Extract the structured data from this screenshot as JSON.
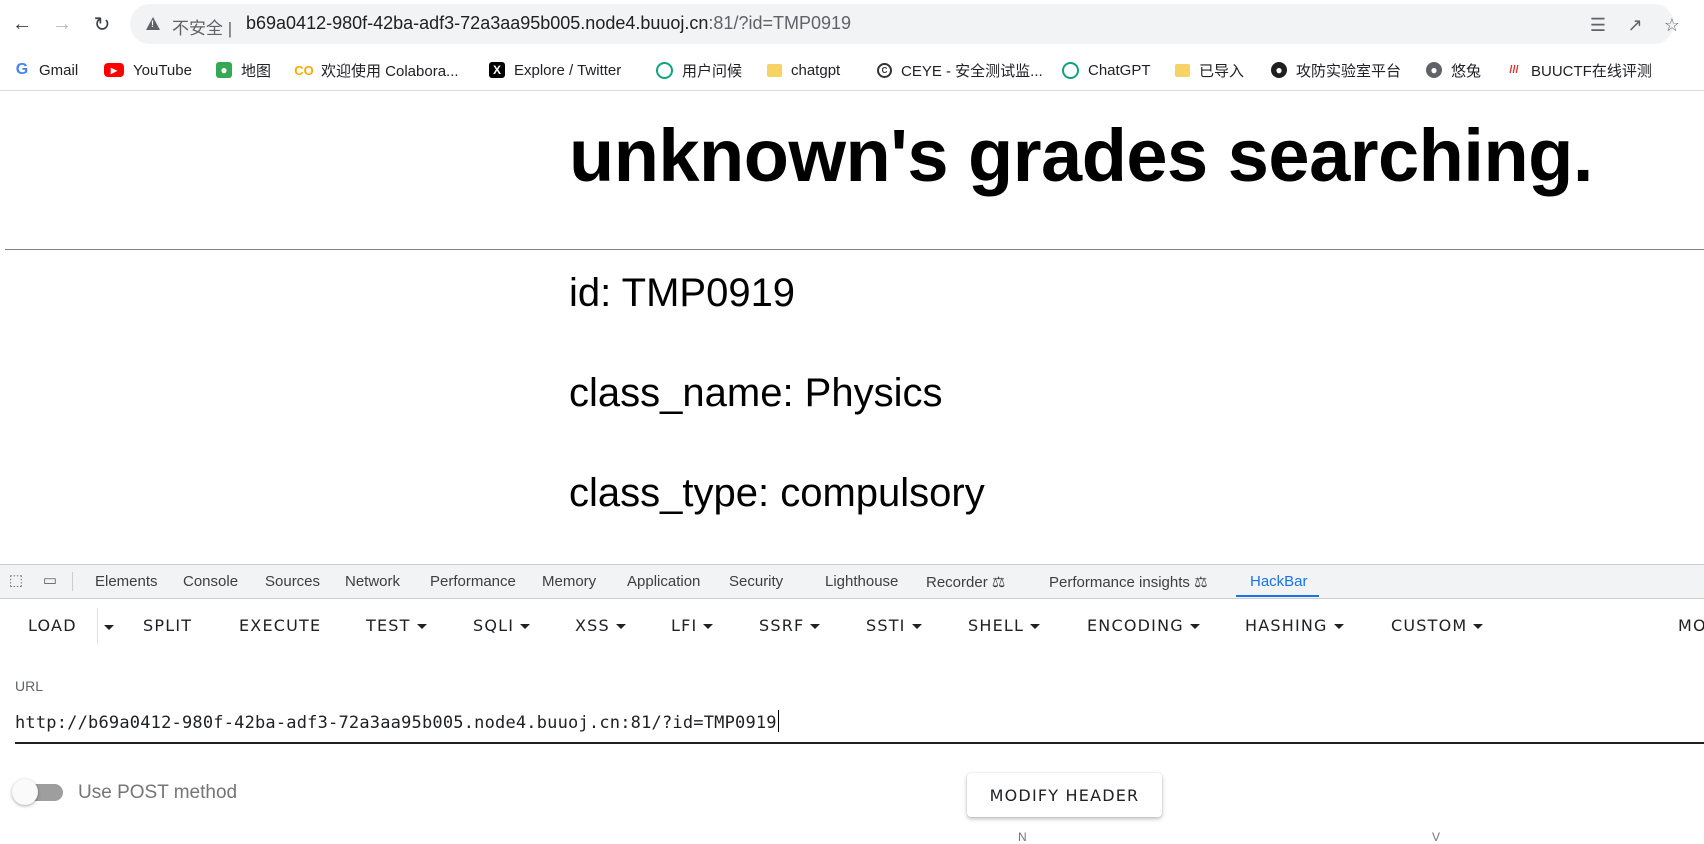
{
  "browser": {
    "insecure_label": "不安全",
    "url_host": "b69a0412-980f-42ba-adf3-72a3aa95b005.node4.buuoj.cn",
    "url_rest": ":81/?id=TMP0919",
    "nav": {
      "back_icon": "arrow-left-icon",
      "forward_icon": "arrow-right-icon",
      "reload_icon": "reload-icon"
    },
    "omnibox_icons": [
      "translate-icon",
      "share-icon",
      "star-icon"
    ]
  },
  "bookmarks": [
    {
      "label": "Gmail",
      "icon": "gmail-icon"
    },
    {
      "label": "YouTube",
      "icon": "youtube-icon"
    },
    {
      "label": "地图",
      "icon": "maps-icon"
    },
    {
      "label": "欢迎使用 Colabora...",
      "icon": "colab-icon"
    },
    {
      "label": "Explore / Twitter",
      "icon": "x-icon"
    },
    {
      "label": "用户问候",
      "icon": "chatgpt-icon"
    },
    {
      "label": "chatgpt",
      "icon": "folder-icon"
    },
    {
      "label": "CEYE - 安全测试监...",
      "icon": "ceye-icon"
    },
    {
      "label": "ChatGPT",
      "icon": "chatgpt-icon"
    },
    {
      "label": "已导入",
      "icon": "folder-icon"
    },
    {
      "label": "攻防实验室平台",
      "icon": "spy-icon"
    },
    {
      "label": "悠兔",
      "icon": "globe-icon"
    },
    {
      "label": "BUUCTF在线评测",
      "icon": "buuctf-icon"
    }
  ],
  "page": {
    "title": "unknown's grades searching.",
    "fields": [
      "id: TMP0919",
      "class_name: Physics",
      "class_type: compulsory"
    ]
  },
  "devtools": {
    "tabs": [
      "Elements",
      "Console",
      "Sources",
      "Network",
      "Performance",
      "Memory",
      "Application",
      "Security",
      "Lighthouse",
      "Recorder",
      "Performance insights",
      "HackBar"
    ],
    "active_tab": "HackBar"
  },
  "hackbar": {
    "buttons": [
      "LOAD",
      "SPLIT",
      "EXECUTE",
      "TEST",
      "SQLI",
      "XSS",
      "LFI",
      "SSRF",
      "SSTI",
      "SHELL",
      "ENCODING",
      "HASHING",
      "CUSTOM",
      "MO"
    ],
    "url_label": "URL",
    "url_value": "http://b69a0412-980f-42ba-adf3-72a3aa95b005.node4.buuoj.cn:81/?id=TMP0919",
    "post_toggle_label": "Use POST method",
    "post_enabled": false,
    "modify_header_label": "MODIFY HEADER",
    "partial_labels": [
      "N",
      "V"
    ]
  }
}
